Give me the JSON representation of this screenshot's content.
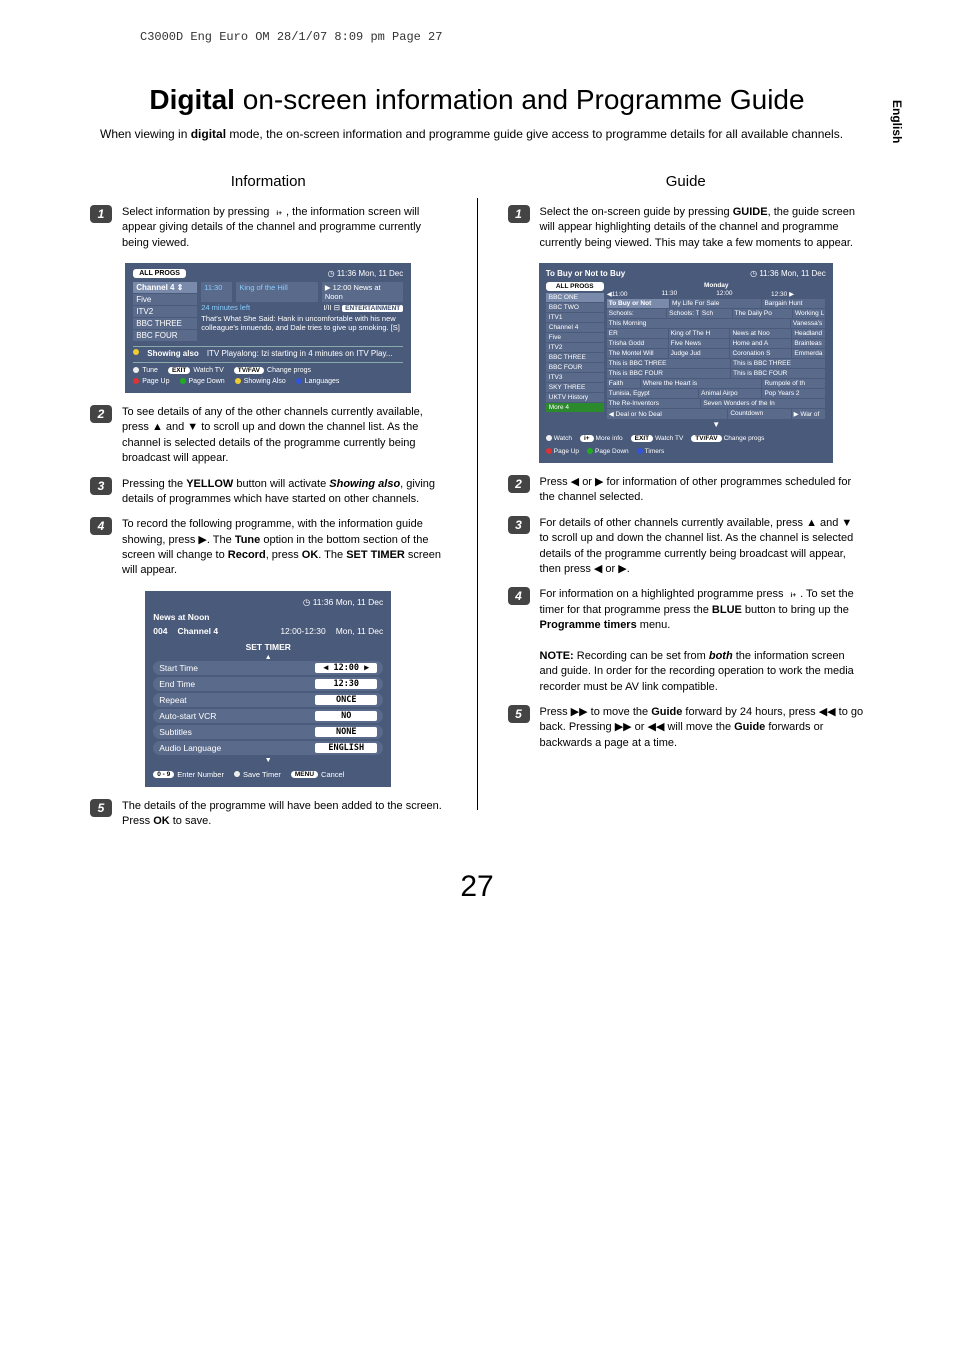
{
  "pageslug": "C3000D Eng Euro OM  28/1/07  8:09 pm  Page 27",
  "side_tab": "English",
  "title_bold": "Digital",
  "title_rest": " on-screen information and Programme Guide",
  "intro_a": "When viewing in ",
  "intro_b": "digital",
  "intro_c": " mode, the on-screen information and programme guide give access to programme details for all available channels.",
  "info_heading": "Information",
  "guide_heading": "Guide",
  "left_steps": {
    "s1a": "Select information by pressing ",
    "s1b": ", the information screen will appear giving details of the channel and programme currently being viewed.",
    "s2": "To see details of any of the other channels currently available, press ▲ and ▼ to scroll up and down the channel list. As the channel is selected details of the programme currently being broadcast will appear.",
    "s3a": "Pressing the ",
    "s3b": "YELLOW",
    "s3c": " button will activate ",
    "s3d": "Showing also",
    "s3e": ", giving details of programmes which have started on other channels.",
    "s4a": "To record the following programme, with the information guide showing, press ▶. The ",
    "s4b": "Tune",
    "s4c": " option in the bottom section of the screen will change to ",
    "s4d": "Record",
    "s4e": ", press ",
    "s4f": "OK",
    "s4g": ". The ",
    "s4h": "SET TIMER",
    "s4i": " screen will appear.",
    "s5a": "The details of the programme will have been added to the screen. Press ",
    "s5b": "OK",
    "s5c": " to save."
  },
  "right_steps": {
    "s1a": "Select the on-screen guide by pressing ",
    "s1b": "GUIDE",
    "s1c": ", the guide screen will appear highlighting details of the channel and programme currently being viewed. This may take a few moments to appear.",
    "s2": "Press ◀ or ▶ for information of other programmes scheduled for the channel selected.",
    "s3": "For details of other channels currently available, press ▲ and ▼ to scroll up and down the channel list. As the channel is selected details of the programme currently being broadcast will appear, then press ◀ or ▶.",
    "s4a": "For information on a highlighted programme press ",
    "s4b": ". To set the timer for that programme press the ",
    "s4c": "BLUE",
    "s4d": " button to bring up the ",
    "s4e": "Programme timers",
    "s4f": " menu.",
    "note_label": "NOTE:",
    "note_a": " Recording can be set from ",
    "note_b": "both",
    "note_c": " the information screen and guide. In order for the recording operation to work the media recorder must be AV link compatible.",
    "s5a": "Press ▶▶ to move the ",
    "s5b": "Guide",
    "s5c": " forward by 24 hours, press ◀◀ to go back. Pressing ▶▶ or ◀◀ will move the ",
    "s5d": "Guide",
    "s5e": " forwards or backwards a page at a time."
  },
  "epg": {
    "allprogs": "ALL PROGS",
    "time": "11:36 Mon, 11 Dec",
    "chs": [
      "Channel 4  ⇕",
      "Five",
      "ITV2",
      "BBC THREE",
      "BBC FOUR"
    ],
    "now_a": "11:30",
    "now_b": "King of the Hill",
    "next_a": "12:00 News at Noon",
    "mins": "24 minutes left",
    "iii": "I/II",
    "ent": "ENTERTAINMENT",
    "desc": "That's What She Said: Hank in uncomfortable with his new colleague's innuendo, and Dale tries to give up smoking. [S]",
    "also_label": "Showing also",
    "also_text": "ITV Playalong: Izi starting in 4 minutes on ITV Play...",
    "foot": {
      "tune": "Tune",
      "exit": "EXIT",
      "watch": "Watch TV",
      "tvfav": "TV/FAV",
      "change": "Change progs",
      "pgup": "Page Up",
      "pgdn": "Page Down",
      "showing": "Showing Also",
      "lang": "Languages"
    }
  },
  "timer": {
    "clock": "11:36 Mon, 11 Dec",
    "prog": "News at Noon",
    "chno": "004",
    "chname": "Channel 4",
    "span": "12:00-12:30",
    "date": "Mon, 11 Dec",
    "head": "SET TIMER",
    "rows": [
      {
        "label": "Start Time",
        "val": "12:00"
      },
      {
        "label": "End Time",
        "val": "12:30"
      },
      {
        "label": "Repeat",
        "val": "ONCE"
      },
      {
        "label": "Auto-start VCR",
        "val": "NO"
      },
      {
        "label": "Subtitles",
        "val": "NONE"
      },
      {
        "label": "Audio Language",
        "val": "ENGLISH"
      }
    ],
    "foot": {
      "enter": "Enter Number",
      "nums": "0 - 9",
      "save": "Save Timer",
      "menu": "MENU",
      "cancel": "Cancel"
    }
  },
  "guide": {
    "title": "To Buy or Not to Buy",
    "clock": "11:36 Mon, 11 Dec",
    "allprogs": "ALL PROGS",
    "day": "Monday",
    "times": [
      "◀11:00",
      "11:30",
      "12:00",
      "12:30   ▶"
    ],
    "chs": [
      "BBC ONE",
      "BBC TWO",
      "ITV1",
      "Channel 4",
      "Five",
      "ITV2",
      "BBC THREE",
      "BBC FOUR",
      "ITV3",
      "SKY THREE",
      "UKTV History",
      "More 4"
    ],
    "rows": [
      [
        {
          "t": "To Buy or Not",
          "w": 2,
          "sel": true
        },
        {
          "t": "My Life For Sale",
          "w": 3
        },
        {
          "t": "Bargain Hunt",
          "w": 2
        }
      ],
      [
        {
          "t": "Schools:",
          "w": 2
        },
        {
          "t": "Schools: Tes",
          "w": 1
        },
        {
          "t": "Sch",
          "w": 1
        },
        {
          "t": "The Daily Po",
          "w": 2
        },
        {
          "t": "Working L",
          "w": 1
        }
      ],
      [
        {
          "t": "This Morning",
          "w": 6
        },
        {
          "t": "Vanessa's",
          "w": 1
        }
      ],
      [
        {
          "t": "ER",
          "w": 2
        },
        {
          "t": "King of The H",
          "w": 2
        },
        {
          "t": "News at Noo",
          "w": 2
        },
        {
          "t": "Headland",
          "w": 1
        }
      ],
      [
        {
          "t": "Trisha Godd",
          "w": 2
        },
        {
          "t": "Five News",
          "w": 2
        },
        {
          "t": "Home and A",
          "w": 2
        },
        {
          "t": "Brainteas",
          "w": 1
        }
      ],
      [
        {
          "t": "The Montel Will",
          "w": 2
        },
        {
          "t": "Judge Jud",
          "w": 2
        },
        {
          "t": "Coronation S",
          "w": 2
        },
        {
          "t": "Emmerda",
          "w": 1
        }
      ],
      [
        {
          "t": "This is BBC THREE",
          "w": 4
        },
        {
          "t": "This is BBC THREE",
          "w": 3
        }
      ],
      [
        {
          "t": "This is BBC FOUR",
          "w": 4
        },
        {
          "t": "This is BBC FOUR",
          "w": 3
        }
      ],
      [
        {
          "t": "Faith",
          "w": 1
        },
        {
          "t": "Where the Heart is",
          "w": 4
        },
        {
          "t": "Rumpole of th",
          "w": 2
        }
      ],
      [
        {
          "t": "Tunisia, Egypt",
          "w": 3
        },
        {
          "t": "Animal Airpo",
          "w": 2
        },
        {
          "t": "Pop Years 2",
          "w": 2
        }
      ],
      [
        {
          "t": "The Re-Inventors",
          "w": 3
        },
        {
          "t": "Seven Wonders of the In",
          "w": 4
        }
      ],
      [
        {
          "t": "◀ Deal or No Deal",
          "w": 4
        },
        {
          "t": "Countdown",
          "w": 2
        },
        {
          "t": "▶ War of",
          "w": 1
        }
      ]
    ],
    "foot": {
      "watch": "Watch",
      "more": "More info",
      "exit": "EXIT",
      "wtv": "Watch TV",
      "tvfav": "TV/FAV",
      "change": "Change progs",
      "pgup": "Page Up",
      "pgdn": "Page Down",
      "timers": "Timers",
      "iplus": "i+"
    }
  },
  "pagenum": "27",
  "iplus_glyph": "i+"
}
